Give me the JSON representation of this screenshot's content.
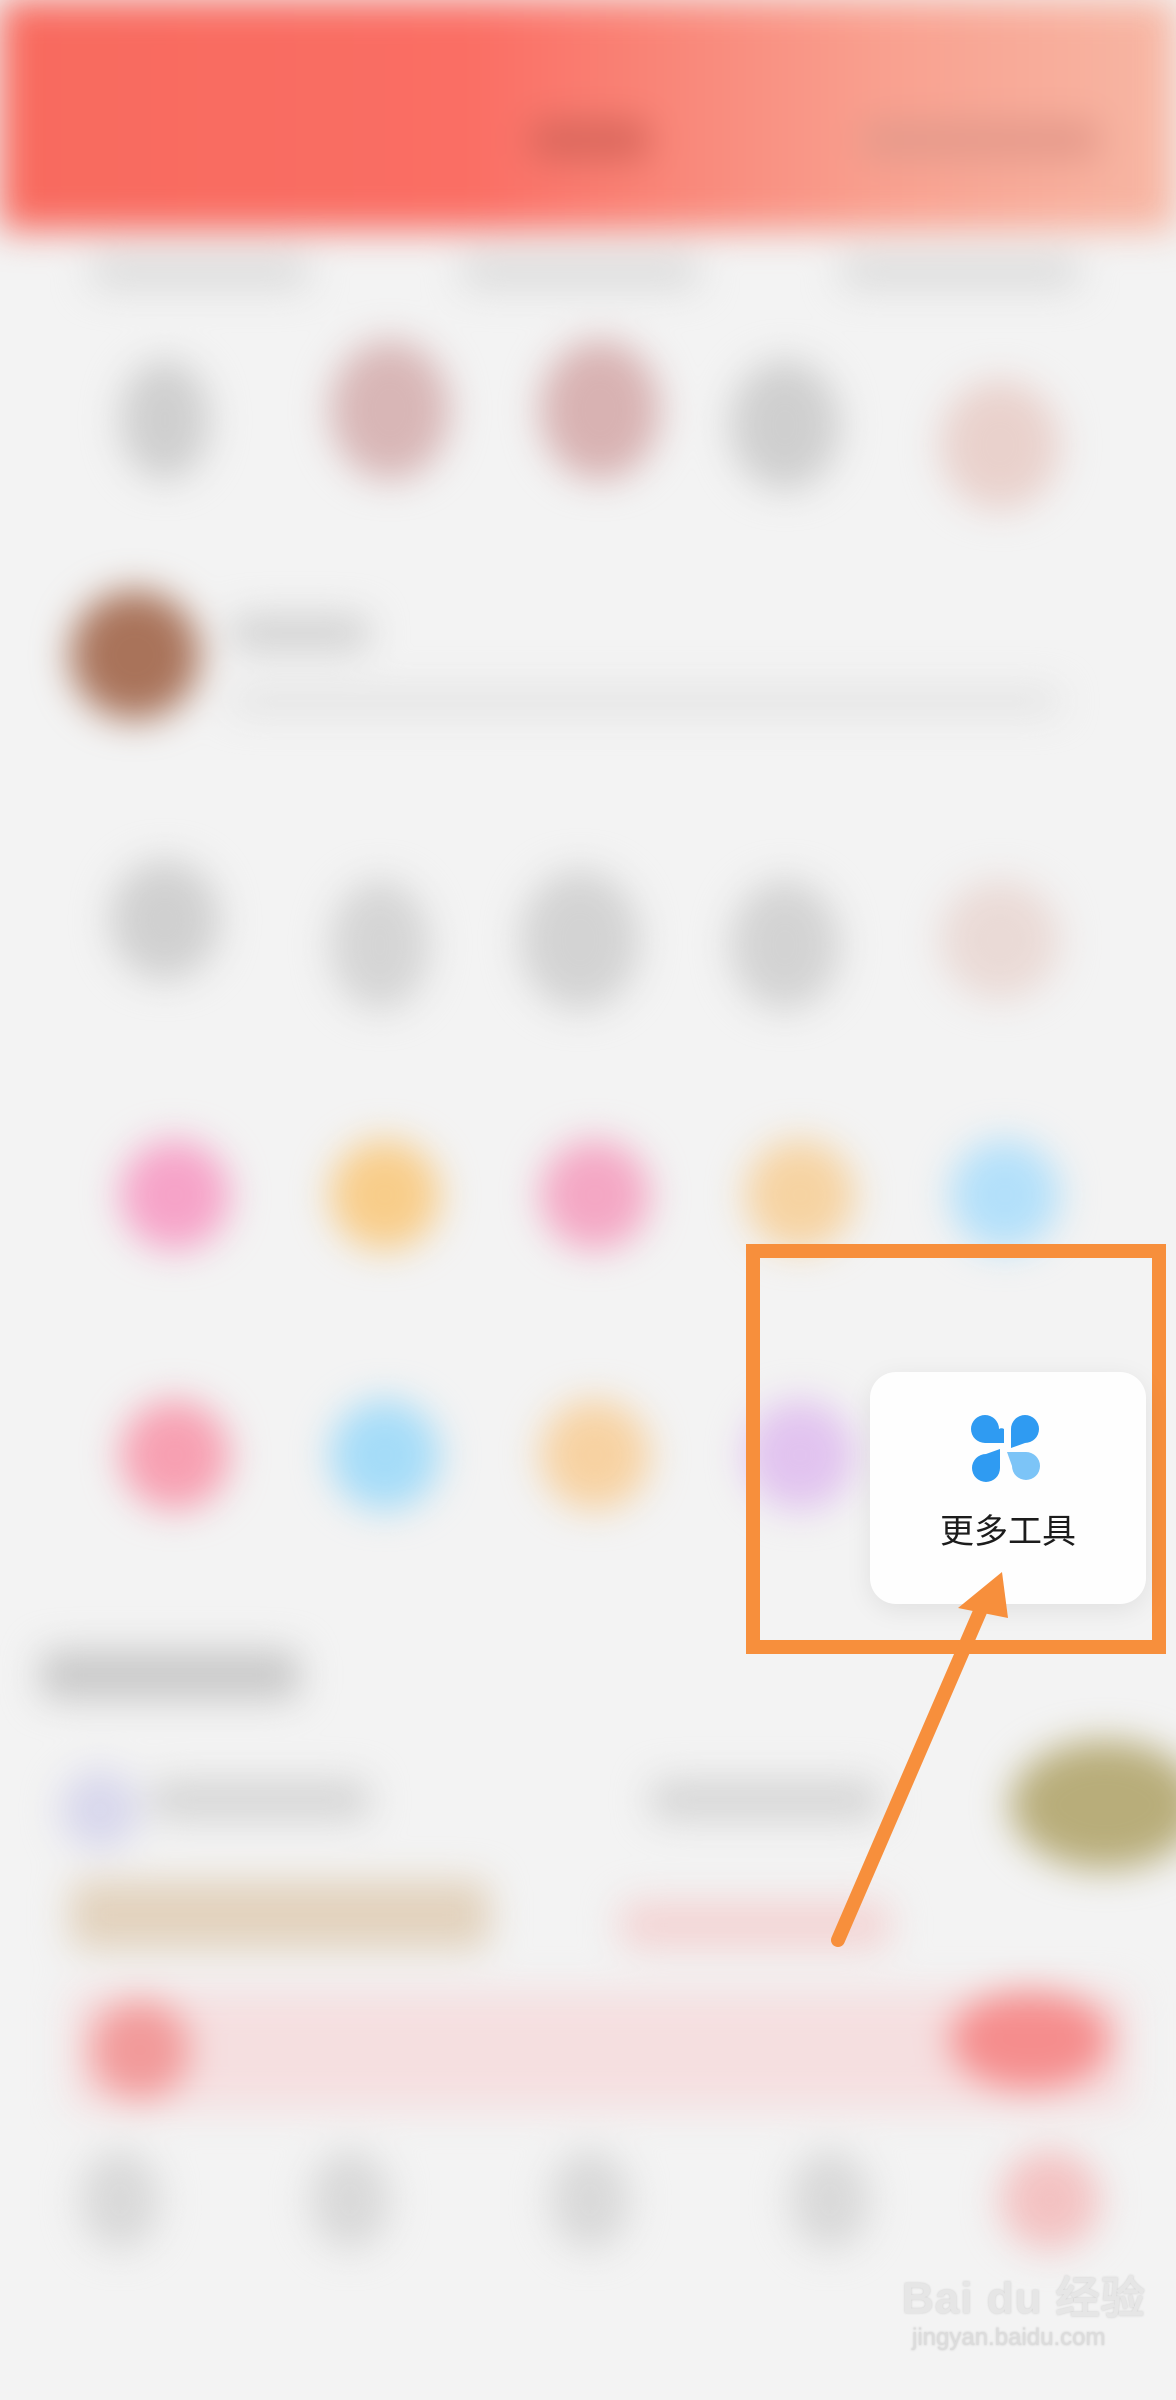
{
  "popup": {
    "label": "更多工具",
    "icon": "four-petal-grid-icon",
    "icon_color": "#2f9bf2"
  },
  "highlight": {
    "color": "#f78f3c"
  },
  "watermark": {
    "brand": "Bai du 经验",
    "url": "jingyan.baidu.com"
  }
}
